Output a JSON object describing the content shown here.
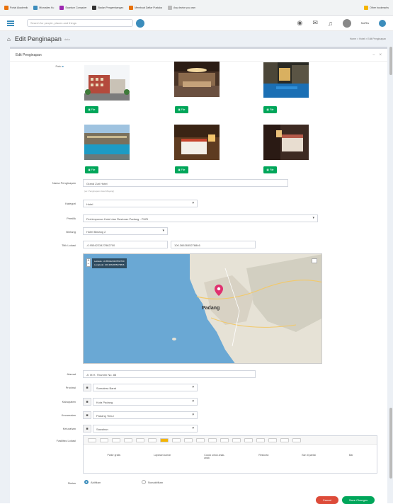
{
  "browser": {
    "bookmarks": [
      {
        "label": "Portal Akademik",
        "color": "#e8710a"
      },
      {
        "label": "Microsites Ku",
        "color": "#3c8dbc"
      },
      {
        "label": "Scantum Computer",
        "color": "#9c27b0"
      },
      {
        "label": "Badan Pengembangan",
        "color": "#333333"
      },
      {
        "label": "Membuat Daftar Pustaka",
        "color": "#e8710a"
      },
      {
        "label": "Any device you own",
        "color": "#bbbbbb"
      },
      {
        "label": "Other bookmarks",
        "color": "#f4b400"
      }
    ]
  },
  "topbar": {
    "search_placeholder": "Search for people, places and things",
    "user": "NURA"
  },
  "page": {
    "title": "Edit Penginapan",
    "subtitle": "data",
    "breadcrumb": "Home > Hotel > Edit Penginapan"
  },
  "form": {
    "box_title": "Edit Penginapan",
    "foto_label": "Foto",
    "file_button": "File",
    "nama_label": "Nama Penginapan",
    "nama_value": "Grand Zuri Hotel",
    "nama_help": "(ex: Penginapan Hotel Mayang)",
    "kategori_label": "Kategori",
    "kategori_value": "Hotel",
    "pemilik_label": "Pemilik",
    "pemilik_value": "Perhimpunan Hotel dan Restoran Padang - PHRI",
    "bintang_label": "Bintang",
    "bintang_value": "Hotel Bintang 2",
    "lokasi_label": "Titik Lokasi",
    "lat_value": "-0.9554223427862700",
    "lng_value": "100.3662655278846",
    "alamat_label": "Alamat",
    "alamat_value": "Jl. M.H. Thamrin No. 88",
    "provinsi_label": "Provinsi",
    "provinsi_value": "Sumatera Barat",
    "kabupaten_label": "Kabupaten",
    "kabupaten_value": "Kota Padang",
    "kecamatan_label": "Kecamatan",
    "kecamatan_value": "Padang Timur",
    "kelurahan_label": "Kelurahan",
    "kelurahan_value": "Sawahan",
    "fasilitas_label": "Fasilitas Lokasi",
    "fasilitas_items": [
      "Parkir gratis",
      "Layanan kamar",
      "Cocok untuk anak-anak",
      "Restoran",
      "Bar di pantai",
      "Bar"
    ],
    "status_label": "Status",
    "status_active": "Aktifkan",
    "status_inactive": "Nonaktifkan",
    "cancel_button": "Cancel",
    "save_button": "Save Changes"
  },
  "map": {
    "city": "Padang",
    "lat_text": "Latitude: -0.9554223427862700",
    "lng_text": "Longitude: 100.3662655278846"
  },
  "colors": {
    "accent": "#3c8dbc",
    "success": "#00a65a",
    "danger": "#dd4b39"
  }
}
